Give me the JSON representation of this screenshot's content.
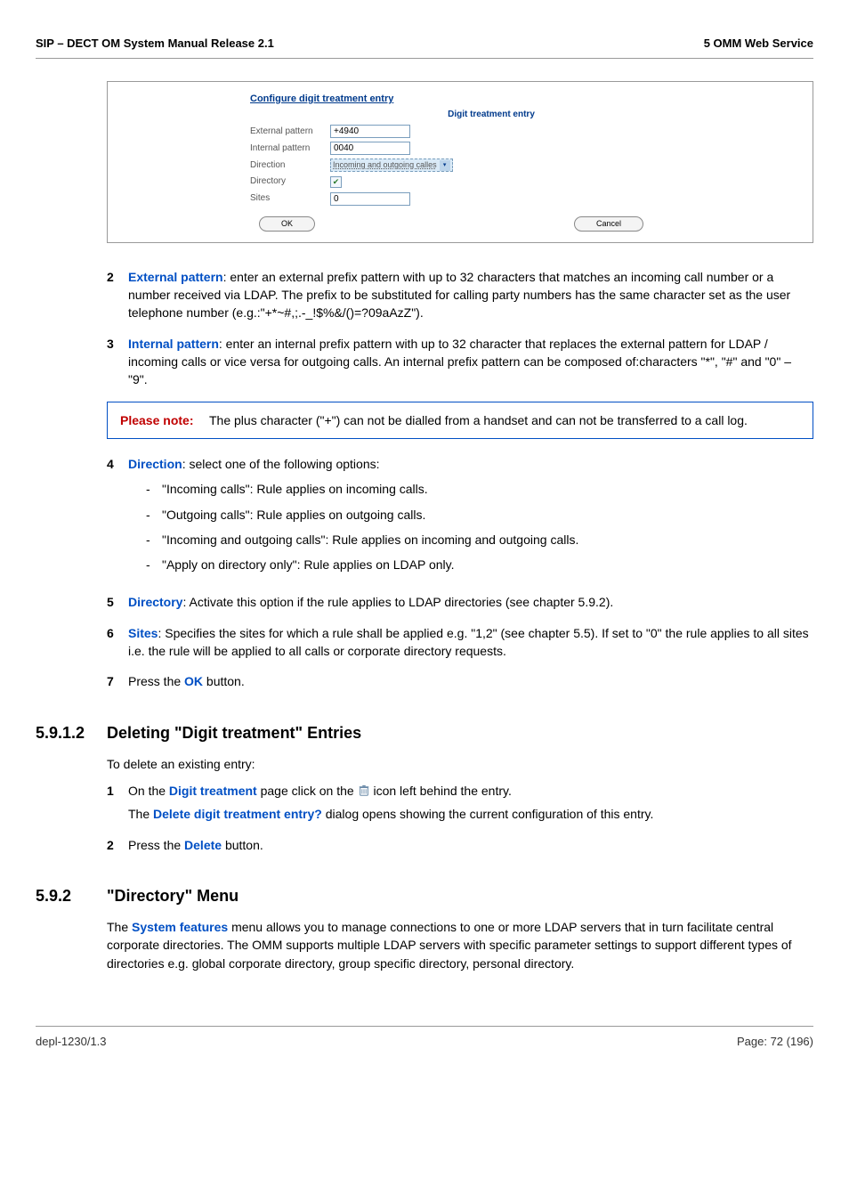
{
  "header": {
    "left": "SIP – DECT OM System Manual Release 2.1",
    "right": "5 OMM Web Service"
  },
  "dialog": {
    "title": "Configure digit treatment entry",
    "subtitle": "Digit treatment entry",
    "rows": {
      "ext_label": "External pattern",
      "ext_value": "+4940",
      "int_label": "Internal pattern",
      "int_value": "0040",
      "dir_label": "Direction",
      "dir_value": "Incoming and outgoing calles",
      "dirc_label": "Directory",
      "sites_label": "Sites",
      "sites_value": "0"
    },
    "ok": "OK",
    "cancel": "Cancel"
  },
  "steps_a": [
    {
      "n": "2",
      "term": "External pattern",
      "text": ": enter an external prefix pattern with up to 32 characters that matches an incoming call number or a number received via LDAP. The prefix to be substituted for calling party numbers has the same character set as the user telephone number (e.g.:\"+*~#,;.-_!$%&/()=?09aAzZ\")."
    },
    {
      "n": "3",
      "term": "Internal pattern",
      "text": ": enter an internal prefix pattern with up to 32 character that replaces the external pattern for LDAP / incoming calls or vice versa for outgoing calls. An internal prefix pattern can be composed of:characters \"*\", \"#\" and \"0\" – \"9\"."
    }
  ],
  "note": {
    "label": "Please note:",
    "text": "The plus character (\"+\") can not be dialled from a handset and can not be transferred to a call log."
  },
  "step4": {
    "n": "4",
    "term": "Direction",
    "text": ": select one of the following options:",
    "items": [
      "\"Incoming calls\": Rule applies on incoming calls.",
      "\"Outgoing calls\": Rule applies on outgoing calls.",
      "\"Incoming and outgoing calls\": Rule applies on incoming and outgoing calls.",
      "\"Apply on directory only\": Rule applies on LDAP only."
    ]
  },
  "step5": {
    "n": "5",
    "term": "Directory",
    "text": ": Activate this option if the rule applies to LDAP directories (see chapter 5.9.2)."
  },
  "step6": {
    "n": "6",
    "term": "Sites",
    "text": ": Specifies the sites for which a rule shall be applied e.g. \"1,2\" (see chapter 5.5). If set to \"0\" the rule applies to all sites i.e. the rule will be applied to all calls or corporate directory requests."
  },
  "step7": {
    "n": "7",
    "pre": "Press the ",
    "term": "OK",
    "post": " button."
  },
  "sec_del": {
    "num": "5.9.1.2",
    "title": "Deleting \"Digit treatment\" Entries",
    "intro": "To delete an existing entry:",
    "s1_pre": "On the ",
    "s1_term": "Digit treatment",
    "s1_mid": " page click on the ",
    "s1_post": " icon left behind the entry.",
    "s1b_pre": "The ",
    "s1b_term": "Delete digit treatment entry?",
    "s1b_post": " dialog opens showing the current configuration of this entry.",
    "s2_pre": "Press the ",
    "s2_term": "Delete",
    "s2_post": " button."
  },
  "sec_dir": {
    "num": "5.9.2",
    "title": "\"Directory\" Menu",
    "p_pre": "The ",
    "p_term": "System features",
    "p_post": " menu allows you to manage connections to one or more LDAP servers that in turn facilitate central corporate directories. The OMM supports multiple LDAP servers with specific parameter settings to support different types of directories e.g. global corporate directory, group specific directory, personal directory."
  },
  "footer": {
    "left": "depl-1230/1.3",
    "right": "Page: 72 (196)"
  }
}
